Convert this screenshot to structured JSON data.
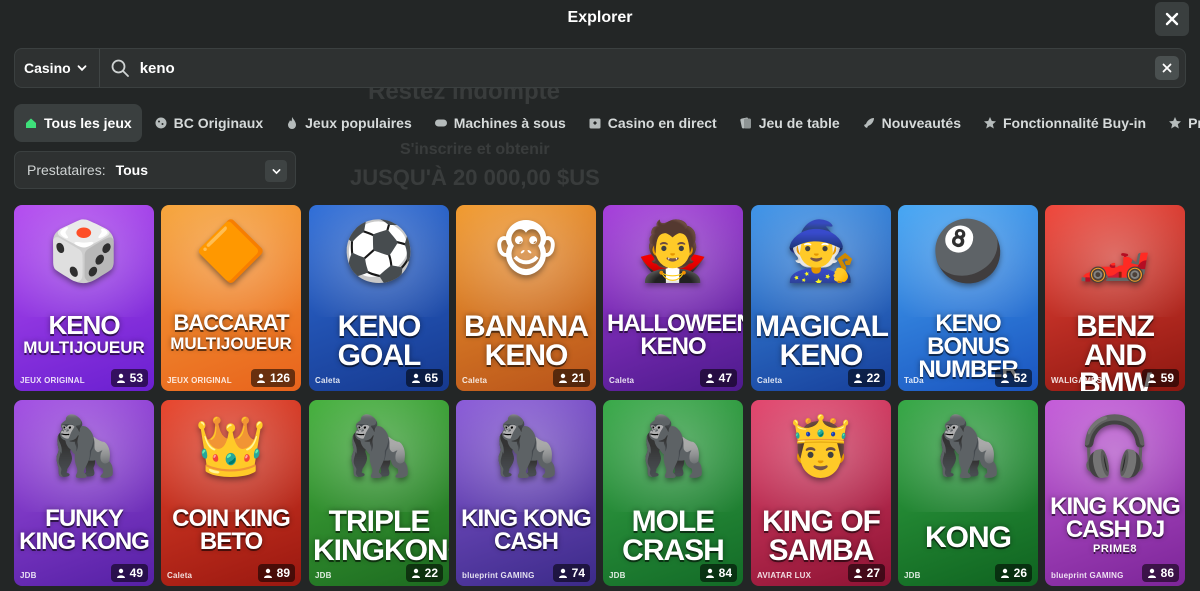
{
  "header": {
    "title": "Explorer"
  },
  "background_text": {
    "line1": "Restez indompté",
    "line2": "S'inscrire et obtenir",
    "line3": "JUSQU'À 20 000,00 $US"
  },
  "search": {
    "category": "Casino",
    "value": "keno"
  },
  "tabs": [
    {
      "label": "Tous les jeux",
      "icon": "home-icon",
      "active": true
    },
    {
      "label": "BC Originaux",
      "icon": "cookie-icon"
    },
    {
      "label": "Jeux populaires",
      "icon": "flame-icon"
    },
    {
      "label": "Machines à sous",
      "icon": "slot-machine-icon"
    },
    {
      "label": "Casino en direct",
      "icon": "live-casino-icon"
    },
    {
      "label": "Jeu de table",
      "icon": "cards-icon"
    },
    {
      "label": "Nouveautés",
      "icon": "rocket-icon"
    },
    {
      "label": "Fonctionnalité Buy-in",
      "icon": "star-icon"
    },
    {
      "label": "Prestataires",
      "icon": "star-icon"
    }
  ],
  "providers": {
    "label": "Prestataires:",
    "value": "Tous"
  },
  "games": [
    {
      "line1": "KENO",
      "line2": "MULTIJOUEUR",
      "brand": "JEUX ORIGINAL",
      "players": "53",
      "art": "🎲",
      "color1": "#b44cf0",
      "color2": "#6a1fd0"
    },
    {
      "line1": "BACCARAT",
      "line2": "MULTIJOUEUR",
      "brand": "JEUX ORIGINAL",
      "players": "126",
      "art": "🔶",
      "color1": "#f6a43a",
      "color2": "#e8631c"
    },
    {
      "line1": "KENO",
      "line2": "GOAL",
      "brand": "Caleta",
      "players": "65",
      "art": "⚽",
      "color1": "#2f6ed8",
      "color2": "#16398f"
    },
    {
      "line1": "BANANA",
      "line2": "KENO",
      "brand": "Caleta",
      "players": "21",
      "art": "🐵",
      "color1": "#f19a2e",
      "color2": "#b8531a"
    },
    {
      "line1": "HALLOWEEN",
      "line2": "KENO",
      "brand": "Caleta",
      "players": "47",
      "art": "🧛",
      "color1": "#a53ddb",
      "color2": "#4d1a8c"
    },
    {
      "line1": "MAGICAL",
      "line2": "KENO",
      "brand": "Caleta",
      "players": "22",
      "art": "🧙",
      "color1": "#3d93e8",
      "color2": "#173f9a"
    },
    {
      "line1": "KENO BONUS",
      "line2": "NUMBER",
      "brand": "TaDa",
      "players": "52",
      "art": "🎱",
      "color1": "#45a6f4",
      "color2": "#1a54bf"
    },
    {
      "line1": "BENZ AND",
      "line2": "BMW",
      "brand": "WALIGAMES",
      "players": "59",
      "art": "🏎️",
      "color1": "#f0463a",
      "color2": "#8c1710"
    },
    {
      "line1": "FUNKY",
      "line2": "KING KONG",
      "brand": "JDB",
      "players": "49",
      "art": "🦍",
      "color1": "#a24ee3",
      "color2": "#5520a4"
    },
    {
      "line1": "COIN KING",
      "line2": "BETO",
      "brand": "Caleta",
      "players": "89",
      "art": "👑",
      "color1": "#e8452c",
      "color2": "#9a1810"
    },
    {
      "line1": "TRIPLE",
      "line2": "KINGKONG",
      "brand": "JDB",
      "players": "22",
      "art": "🦍",
      "color1": "#44b03c",
      "color2": "#1d6b20"
    },
    {
      "line1": "KING KONG",
      "line2": "CASH",
      "brand": "blueprint GAMING",
      "players": "74",
      "art": "🦍",
      "color1": "#8a5ad8",
      "color2": "#3b2a88"
    },
    {
      "line1": "MOLE",
      "line2": "CRASH",
      "brand": "JDB",
      "players": "84",
      "art": "🦍",
      "color1": "#38a948",
      "color2": "#136b27"
    },
    {
      "line1": "KING OF",
      "line2": "SAMBA",
      "brand": "AVIATAR LUX",
      "players": "27",
      "art": "🤴",
      "color1": "#e2456d",
      "color2": "#8e1334"
    },
    {
      "line1": "KONG",
      "line2": "",
      "brand": "JDB",
      "players": "26",
      "art": "🦍",
      "color1": "#34a744",
      "color2": "#0f6320"
    },
    {
      "line1": "KING KONG",
      "line2": "CASH DJ",
      "sub": "PRIME8",
      "brand": "blueprint GAMING",
      "players": "86",
      "art": "🎧",
      "color1": "#c45bd9",
      "color2": "#7c2598"
    }
  ],
  "colors": {
    "background": "#232626",
    "panel": "#2e3131",
    "active_tab": "#3a3f3f"
  }
}
